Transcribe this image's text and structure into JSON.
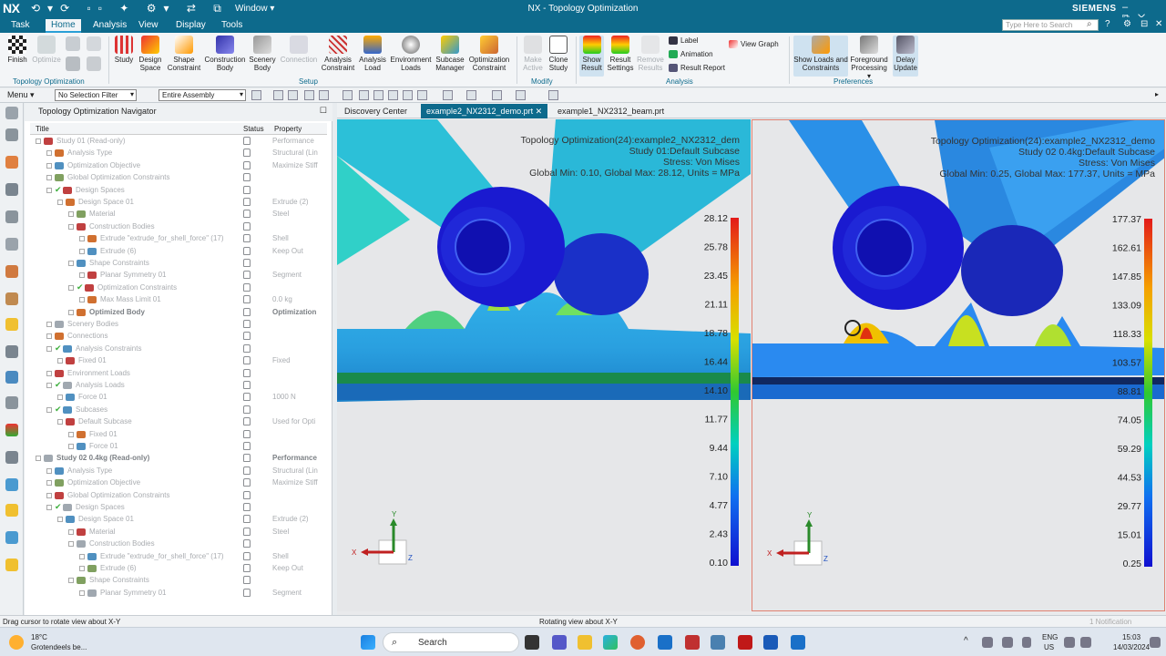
{
  "app": {
    "logo": "NX",
    "window_menu": "Window ▾",
    "title": "NX - Topology Optimization",
    "brand": "SIEMENS",
    "search_placeholder": "Type Here to Search"
  },
  "tabs": [
    "Task",
    "Home",
    "Analysis",
    "View",
    "Display",
    "Tools"
  ],
  "ribbon": {
    "topology_group": [
      "Finish",
      "Optimize"
    ],
    "setup_group": [
      "Study",
      "Design Space",
      "Shape Constraint",
      "Construction Body",
      "Scenery Body",
      "Connection",
      "Analysis Constraint",
      "Analysis Load",
      "Environment Loads",
      "Subcase Manager",
      "Optimization Constraint"
    ],
    "modify_group": [
      "Make Active",
      "Clone Study"
    ],
    "analysis_group": [
      "Show Result",
      "Result Settings",
      "Remove Results"
    ],
    "analysis_small": [
      "Label",
      "Animation",
      "Result Report"
    ],
    "view_graph": "View Graph",
    "preferences_group": [
      "Show Loads and Constraints",
      "Foreground Processing ▾",
      "Delay Update"
    ],
    "group_labels": {
      "topology": "Topology Optimization",
      "setup": "Setup",
      "modify": "Modify",
      "analysis": "Analysis",
      "preferences": "Preferences"
    }
  },
  "toolbar": {
    "menu": "Menu ▾",
    "selection_filter": "No Selection Filter",
    "assembly": "Entire Assembly"
  },
  "navigator": {
    "title": "Topology Optimization Navigator",
    "columns": [
      "Title",
      "Status",
      "Property"
    ],
    "rows": [
      {
        "title": "Study 01 (Read-only)",
        "prop": "Performance",
        "indent": 0,
        "bold": false
      },
      {
        "title": "Analysis Type",
        "prop": "Structural (Lin",
        "indent": 1
      },
      {
        "title": "Optimization Objective",
        "prop": "Maximize Stiff",
        "indent": 1
      },
      {
        "title": "Global Optimization Constraints",
        "prop": "",
        "indent": 1
      },
      {
        "title": "Design Spaces",
        "prop": "",
        "indent": 1,
        "check": true
      },
      {
        "title": "Design Space 01",
        "prop": "Extrude (2)",
        "indent": 2
      },
      {
        "title": "Material",
        "prop": "Steel",
        "indent": 3
      },
      {
        "title": "Construction Bodies",
        "prop": "",
        "indent": 3
      },
      {
        "title": "Extrude \"extrude_for_shell_force\" (17)",
        "prop": "Shell",
        "indent": 4
      },
      {
        "title": "Extrude (6)",
        "prop": "Keep Out",
        "indent": 4
      },
      {
        "title": "Shape Constraints",
        "prop": "",
        "indent": 3
      },
      {
        "title": "Planar Symmetry 01",
        "prop": "Segment",
        "indent": 4
      },
      {
        "title": "Optimization Constraints",
        "prop": "",
        "indent": 3,
        "check": true
      },
      {
        "title": "Max Mass Limit 01",
        "prop": "0.0 kg",
        "indent": 4
      },
      {
        "title": "Optimized Body",
        "prop": "Optimization",
        "indent": 3,
        "bold": true
      },
      {
        "title": "Scenery Bodies",
        "prop": "",
        "indent": 1
      },
      {
        "title": "Connections",
        "prop": "",
        "indent": 1
      },
      {
        "title": "Analysis Constraints",
        "prop": "",
        "indent": 1,
        "check": true
      },
      {
        "title": "Fixed 01",
        "prop": "Fixed",
        "indent": 2
      },
      {
        "title": "Environment Loads",
        "prop": "",
        "indent": 1
      },
      {
        "title": "Analysis Loads",
        "prop": "",
        "indent": 1,
        "check": true
      },
      {
        "title": "Force 01",
        "prop": "1000 N",
        "indent": 2
      },
      {
        "title": "Subcases",
        "prop": "",
        "indent": 1,
        "check": true
      },
      {
        "title": "Default Subcase",
        "prop": "Used for Opti",
        "indent": 2
      },
      {
        "title": "Fixed 01",
        "prop": "",
        "indent": 3
      },
      {
        "title": "Force 01",
        "prop": "",
        "indent": 3
      },
      {
        "title": "Study 02 0.4kg (Read-only)",
        "prop": "Performance",
        "indent": 0,
        "bold": true
      },
      {
        "title": "Analysis Type",
        "prop": "Structural (Lin",
        "indent": 1
      },
      {
        "title": "Optimization Objective",
        "prop": "Maximize Stiff",
        "indent": 1
      },
      {
        "title": "Global Optimization Constraints",
        "prop": "",
        "indent": 1
      },
      {
        "title": "Design Spaces",
        "prop": "",
        "indent": 1,
        "check": true
      },
      {
        "title": "Design Space 01",
        "prop": "Extrude (2)",
        "indent": 2
      },
      {
        "title": "Material",
        "prop": "Steel",
        "indent": 3
      },
      {
        "title": "Construction Bodies",
        "prop": "",
        "indent": 3
      },
      {
        "title": "Extrude \"extrude_for_shell_force\" (17)",
        "prop": "Shell",
        "indent": 4
      },
      {
        "title": "Extrude (6)",
        "prop": "Keep Out",
        "indent": 4
      },
      {
        "title": "Shape Constraints",
        "prop": "",
        "indent": 3
      },
      {
        "title": "Planar Symmetry 01",
        "prop": "Segment",
        "indent": 4
      }
    ]
  },
  "view_tabs": [
    "Discovery Center",
    "example2_NX2312_demo.prt",
    "example1_NX2312_beam.prt"
  ],
  "left_view": {
    "lines": [
      "Topology Optimization(24):example2_NX2312_dem",
      "Study 01:Default Subcase",
      "Stress: Von Mises",
      "Global Min: 0.10, Global Max: 28.12, Units = MPa"
    ],
    "legend": [
      "28.12",
      "25.78",
      "23.45",
      "21.11",
      "18.78",
      "16.44",
      "14.10",
      "11.77",
      "9.44",
      "7.10",
      "4.77",
      "2.43",
      "0.10"
    ]
  },
  "right_view": {
    "lines": [
      "Topology Optimization(24):example2_NX2312_demo",
      "Study 02 0.4kg:Default Subcase",
      "Stress: Von Mises",
      "Global Min: 0.25, Global Max: 177.37, Units = MPa"
    ],
    "legend": [
      "177.37",
      "162.61",
      "147.85",
      "133.09",
      "118.33",
      "103.57",
      "88.81",
      "74.05",
      "59.29",
      "44.53",
      "29.77",
      "15.01",
      "0.25"
    ]
  },
  "triad": {
    "x": "X",
    "y": "Y",
    "z": "Z"
  },
  "status": {
    "left": "Drag cursor to rotate view about X-Y",
    "center": "Rotating view about X-Y",
    "right": "1 Notification"
  },
  "taskbar": {
    "weather_temp": "18°C",
    "weather_text": "Grotendeels be...",
    "search": "Search",
    "lang1": "ENG",
    "lang2": "US",
    "time": "15:03",
    "date": "14/03/2024"
  }
}
